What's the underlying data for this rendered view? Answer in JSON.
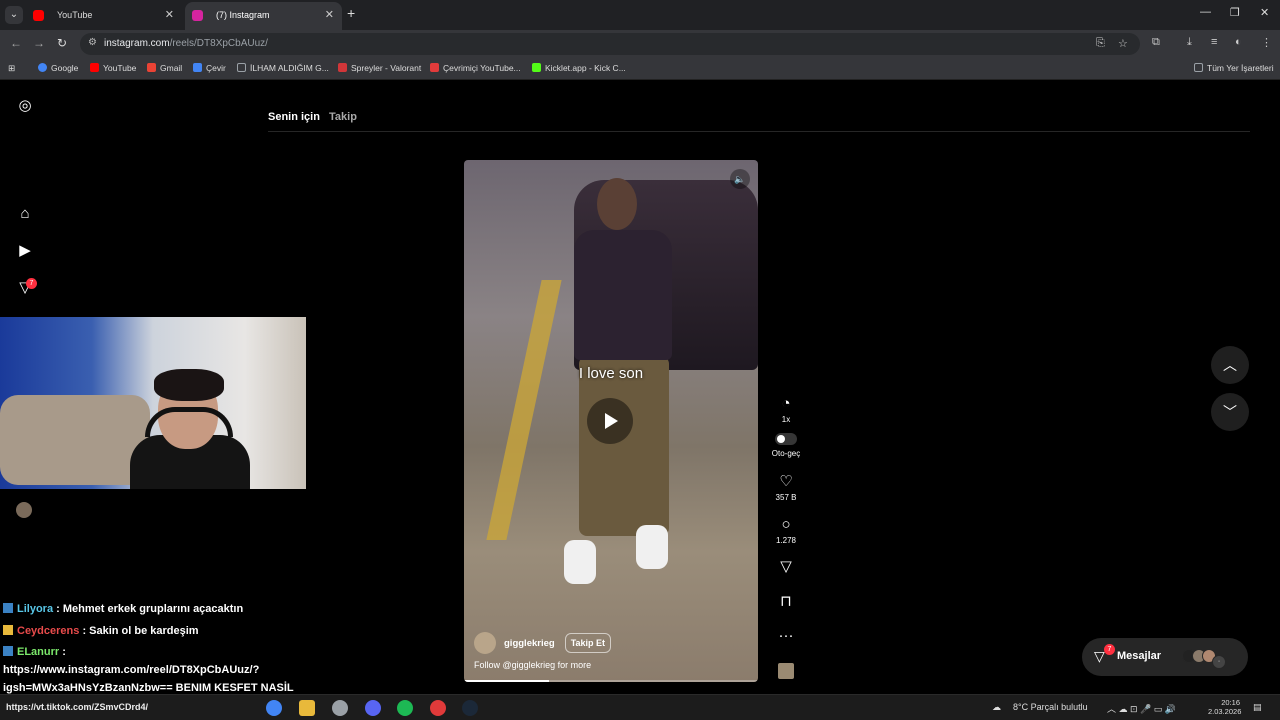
{
  "browser": {
    "tabs": [
      {
        "title": "YouTube",
        "active": false,
        "favicon_color": "#ff0000"
      },
      {
        "title": "(7) Instagram",
        "active": true,
        "favicon_color": "#d6249f"
      }
    ],
    "url_host": "instagram.com",
    "url_path": "/reels/DT8XpCbAUuz/",
    "bookmarks": [
      {
        "label": "Google",
        "icon_color": "#4285f4"
      },
      {
        "label": "YouTube",
        "icon_color": "#ff0000"
      },
      {
        "label": "Gmail",
        "icon_color": "#ea4335"
      },
      {
        "label": "Çevir",
        "icon_color": "#4285f4"
      },
      {
        "label": "İLHAM ALDIĞIM G...",
        "icon_color": "#9aa0a6"
      },
      {
        "label": "Spreyler - Valorant",
        "icon_color": "#d13639"
      },
      {
        "label": "Çevrimiçi YouTube...",
        "icon_color": "#e23b3b"
      },
      {
        "label": "Kicklet.app - Kick C...",
        "icon_color": "#53fc18"
      }
    ],
    "all_bookmarks": "Tüm Yer İşaretleri"
  },
  "instagram": {
    "feed_tabs": [
      "Senin için",
      "Takip"
    ],
    "notification_count": "7",
    "video": {
      "caption_overlay": "I love son",
      "author": "gigglekrieg",
      "follow_label": "Takip Et",
      "description": "Follow @gigglekrieg for more",
      "progress": 0.29
    },
    "actions": {
      "speed": "1x",
      "autoplay": "Oto-geç",
      "likes": "357 B",
      "comments": "1.278"
    },
    "messages_label": "Mesajlar",
    "messages_badge": "7"
  },
  "chat": [
    {
      "user": "Lilyora",
      "text": ": Mehmet erkek gruplarını açacaktın"
    },
    {
      "user": "Ceydcerens",
      "text": ": Sakin ol be kardeşim"
    },
    {
      "user": "ELanurr",
      "text": ":"
    },
    {
      "user": "",
      "text": "https://www.instagram.com/reel/DT8XpCbAUuz/?"
    },
    {
      "user": "",
      "text": "igsh=MWx3aHNsYzBzanNzbw== BENIM KESFET NASİL"
    }
  ],
  "taskbar": {
    "running_text": "https://vt.tiktok.com/ZSmvCDrd4/",
    "weather": "8°C  Parçalı bulutlu",
    "time": "20:16",
    "date": "2.03.2026"
  }
}
